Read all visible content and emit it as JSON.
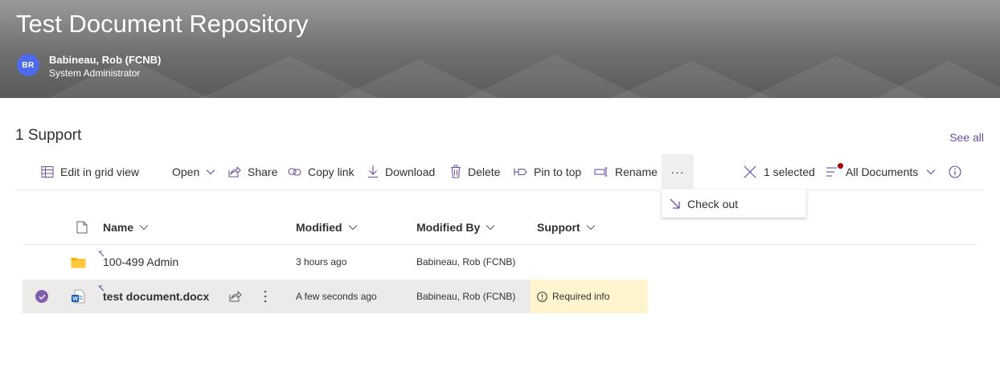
{
  "site": {
    "title": "Test Document Repository",
    "user": {
      "initials": "BR",
      "name": "Babineau, Rob (FCNB)",
      "role": "System Administrator"
    }
  },
  "library": {
    "title": "1 Support",
    "see_all": "See all"
  },
  "commands": {
    "edit_grid": "Edit in grid view",
    "open": "Open",
    "share": "Share",
    "copy_link": "Copy link",
    "download": "Download",
    "delete": "Delete",
    "pin_to_top": "Pin to top",
    "rename": "Rename",
    "more": "···",
    "selected": "1 selected",
    "view": "All Documents"
  },
  "more_menu": {
    "items": [
      {
        "label": "Check out",
        "icon": "check-out-icon"
      }
    ]
  },
  "list": {
    "columns": {
      "name": "Name",
      "modified": "Modified",
      "modified_by": "Modified By",
      "support": "Support"
    },
    "rows": [
      {
        "type": "folder",
        "name": "100-499 Admin",
        "modified": "3 hours ago",
        "modified_by": "Babineau, Rob (FCNB)",
        "support": "",
        "selected": false
      },
      {
        "type": "word-document",
        "name": "test document.docx",
        "modified": "A few seconds ago",
        "modified_by": "Babineau, Rob (FCNB)",
        "support": "Required info",
        "selected": true
      }
    ]
  },
  "colors": {
    "accent": "#6b4fa0",
    "avatar": "#4f6bed",
    "required_info_bg": "#fff4ce",
    "selected_row_bg": "#edebe9",
    "notification_dot": "#a80000"
  }
}
